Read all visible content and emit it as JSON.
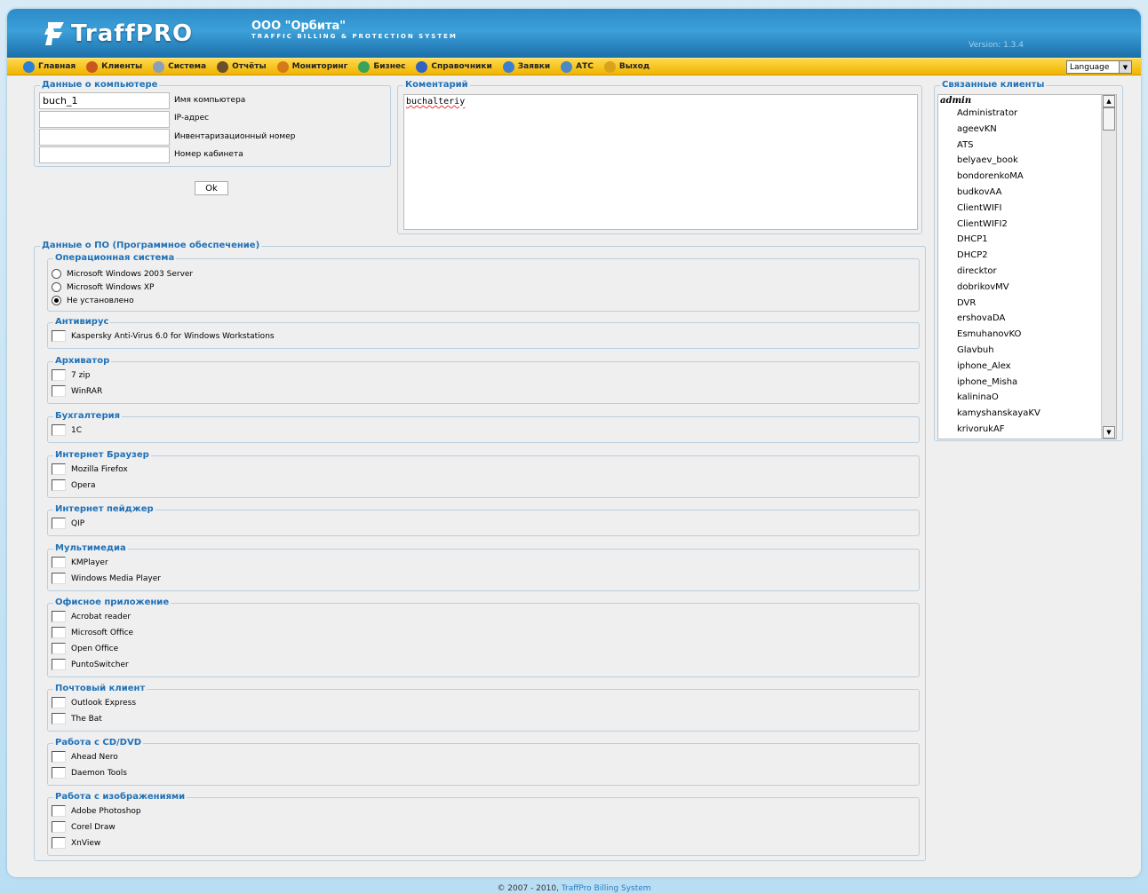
{
  "header": {
    "app_name": "TraffPRO",
    "company_name": "ООО \"Орбита\"",
    "tagline": "TRAFFIC BILLING & PROTECTION SYSTEM",
    "version": "Version: 1.3.4"
  },
  "menu": [
    {
      "label": "Главная",
      "icon": "globe-icon",
      "color": "#2b7fd6"
    },
    {
      "label": "Клиенты",
      "icon": "users-icon",
      "color": "#c8581f"
    },
    {
      "label": "Система",
      "icon": "gears-icon",
      "color": "#8aa0b8"
    },
    {
      "label": "Отчёты",
      "icon": "reports-icon",
      "color": "#6b4f2a"
    },
    {
      "label": "Мониторинг",
      "icon": "monitor-icon",
      "color": "#d47a1a"
    },
    {
      "label": "Бизнес",
      "icon": "business-icon",
      "color": "#3aa35a"
    },
    {
      "label": "Справочники",
      "icon": "directory-icon",
      "color": "#2f62c2"
    },
    {
      "label": "Заявки",
      "icon": "requests-icon",
      "color": "#3a7fcf"
    },
    {
      "label": "АТС",
      "icon": "phone-icon",
      "color": "#4b88c7"
    },
    {
      "label": "Выход",
      "icon": "power-icon",
      "color": "#d9a21a"
    }
  ],
  "language": "Language",
  "computer": {
    "legend": "Данные о компьютере",
    "name_value": "buch_1",
    "name_label": "Имя компьютера",
    "ip_value": "",
    "ip_label": "IP-адрес",
    "inventory_value": "",
    "inventory_label": "Инвентаризационный номер",
    "room_value": "",
    "room_label": "Номер кабинета",
    "ok_label": "Ok"
  },
  "comment": {
    "legend": "Коментарий",
    "value": "buchalteriy"
  },
  "linked": {
    "legend": "Связанные клиенты",
    "group": "admin",
    "items": [
      "Administrator",
      "ageevKN",
      "ATS",
      "belyaev_book",
      "bondorenkoMA",
      "budkovAA",
      "ClientWIFI",
      "ClientWIFI2",
      "DHCP1",
      "DHCP2",
      "direcktor",
      "dobrikovMV",
      "DVR",
      "ershovaDA",
      "EsmuhanovKO",
      "Glavbuh",
      "iphone_Alex",
      "iphone_Misha",
      "kalininaO",
      "kamyshanskayaKV",
      "krivorukAF"
    ]
  },
  "software": {
    "legend": "Данные о ПО (Программное обеспечение)",
    "os": {
      "legend": "Операционная система",
      "options": [
        "Microsoft Windows 2003 Server",
        "Microsoft Windows XP",
        "Не установлено"
      ],
      "selected": "Не установлено"
    },
    "groups": [
      {
        "legend": "Антивирус",
        "items": [
          "Kaspersky Anti-Virus 6.0 for Windows Workstations"
        ]
      },
      {
        "legend": "Архиватор",
        "items": [
          "7 zip",
          "WinRAR"
        ]
      },
      {
        "legend": "Бухгалтерия",
        "items": [
          "1C"
        ]
      },
      {
        "legend": "Интернет Браузер",
        "items": [
          "Mozilla Firefox",
          "Opera"
        ]
      },
      {
        "legend": "Интернет пейджер",
        "items": [
          "QIP"
        ]
      },
      {
        "legend": "Мультимедиа",
        "items": [
          "KMPlayer",
          "Windows Media Player"
        ]
      },
      {
        "legend": "Офисное приложение",
        "items": [
          "Acrobat reader",
          "Microsoft Office",
          "Open Office",
          "PuntoSwitcher"
        ]
      },
      {
        "legend": "Почтовый клиент",
        "items": [
          "Outlook Express",
          "The Bat"
        ]
      },
      {
        "legend": "Работа с CD/DVD",
        "items": [
          "Ahead Nero",
          "Daemon Tools"
        ]
      },
      {
        "legend": "Работа с изображениями",
        "items": [
          "Adobe Photoshop",
          "Corel Draw",
          "XnView"
        ]
      }
    ]
  },
  "footer": {
    "copyright": "© 2007 - 2010,",
    "link": "TraffPro Billing System"
  }
}
